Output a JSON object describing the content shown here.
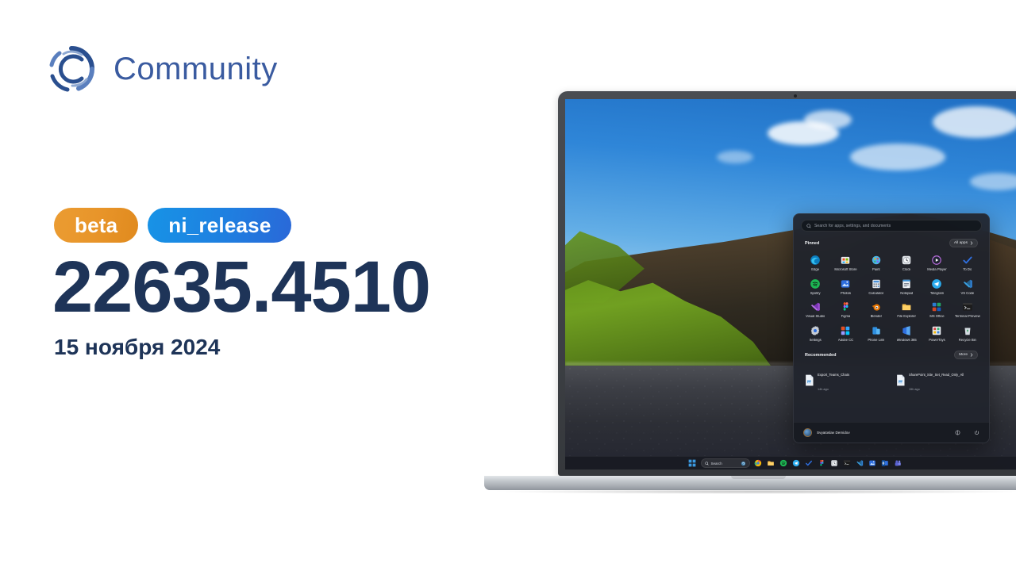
{
  "brand": {
    "name": "Community",
    "logo_icon": "community-c-logo",
    "color": "#3a5ba0"
  },
  "release": {
    "badges": [
      {
        "label": "beta",
        "color": "#e8952a"
      },
      {
        "label": "ni_release",
        "color": "#1f7fe0"
      }
    ],
    "build_number": "22635.4510",
    "date": "15 ноября 2024",
    "text_color": "#1e3458"
  },
  "device": {
    "type": "laptop",
    "frame_color": "#3f4247",
    "base_color": "#c3c8cd"
  },
  "start_menu": {
    "search": {
      "placeholder": "Search for apps, settings, and documents",
      "icon": "search-icon"
    },
    "pinned": {
      "title": "Pinned",
      "all_apps_label": "All apps",
      "all_apps_icon": "chevron-right-icon",
      "apps": [
        {
          "label": "Edge",
          "icon": "edge-icon"
        },
        {
          "label": "Microsoft Store",
          "icon": "microsoft-store-icon"
        },
        {
          "label": "Paint",
          "icon": "paint-icon"
        },
        {
          "label": "Clock",
          "icon": "clock-icon"
        },
        {
          "label": "Media Player",
          "icon": "media-player-icon"
        },
        {
          "label": "To Do",
          "icon": "to-do-icon"
        },
        {
          "label": "Spotify",
          "icon": "spotify-icon"
        },
        {
          "label": "Photos",
          "icon": "photos-icon"
        },
        {
          "label": "Calculator",
          "icon": "calculator-icon"
        },
        {
          "label": "Notepad",
          "icon": "notepad-icon"
        },
        {
          "label": "Telegram",
          "icon": "telegram-icon"
        },
        {
          "label": "VS Code",
          "icon": "vs-code-icon"
        },
        {
          "label": "Visual Studio",
          "icon": "visual-studio-icon"
        },
        {
          "label": "Figma",
          "icon": "figma-icon"
        },
        {
          "label": "Blender",
          "icon": "blender-icon"
        },
        {
          "label": "File Explorer",
          "icon": "file-explorer-icon"
        },
        {
          "label": "MS Office",
          "icon": "ms-office-icon"
        },
        {
          "label": "Terminal Preview",
          "icon": "terminal-preview-icon"
        },
        {
          "label": "Settings",
          "icon": "settings-icon"
        },
        {
          "label": "Adobe CC",
          "icon": "adobe-cc-icon"
        },
        {
          "label": "Phone Link",
          "icon": "phone-link-icon"
        },
        {
          "label": "Windows 365",
          "icon": "windows-365-icon"
        },
        {
          "label": "PowerToys",
          "icon": "powertoys-icon"
        },
        {
          "label": "Recycle Bin",
          "icon": "recycle-bin-icon"
        }
      ]
    },
    "recommended": {
      "title": "Recommended",
      "more_label": "More",
      "more_icon": "chevron-right-icon",
      "items": [
        {
          "name": "Export_Teams_Chats",
          "subtitle": "14h ago",
          "icon": "document-icon"
        },
        {
          "name": "SharePoint_Site_Set_Read_Only_All",
          "subtitle": "15h ago",
          "icon": "document-icon"
        }
      ]
    },
    "user": {
      "name": "Svyatoslav Demidov",
      "avatar_icon": "avatar",
      "actions": [
        {
          "icon": "storage-icon"
        },
        {
          "icon": "power-icon"
        }
      ]
    }
  },
  "taskbar": {
    "start_icon": "windows-start-icon",
    "search": {
      "label": "Search",
      "icon": "search-icon",
      "copilot_icon": "copilot-icon"
    },
    "items": [
      {
        "icon": "chrome-icon"
      },
      {
        "icon": "file-explorer-icon"
      },
      {
        "icon": "spotify-icon"
      },
      {
        "icon": "telegram-icon"
      },
      {
        "icon": "to-do-icon"
      },
      {
        "icon": "figma-icon"
      },
      {
        "icon": "clock-icon"
      },
      {
        "icon": "terminal-icon"
      },
      {
        "icon": "vs-code-icon"
      },
      {
        "icon": "photos-icon"
      },
      {
        "icon": "outlook-icon"
      },
      {
        "icon": "teams-icon"
      }
    ]
  }
}
